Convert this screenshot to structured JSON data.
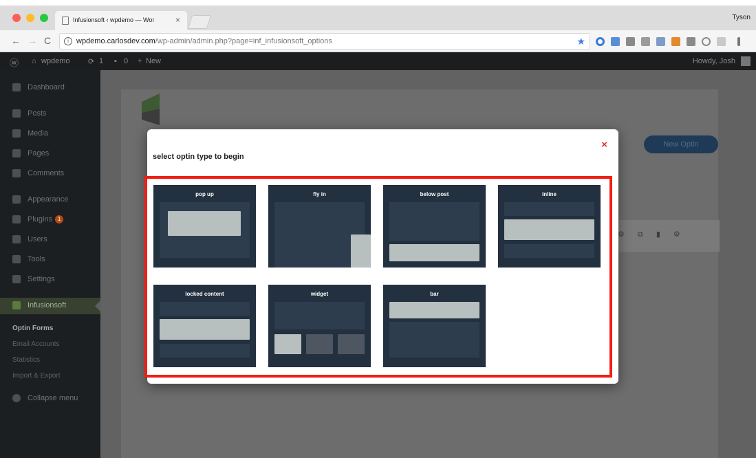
{
  "browser": {
    "tab_title": "Infusionsoft ‹ wpdemo — Wor",
    "tab_close": "×",
    "profile_name": "Tyson",
    "url_host": "wpdemo.carlosdev.com",
    "url_path": "/wp-admin/admin.php?page=inf_infusionsoft_options",
    "nav_back": "←",
    "nav_forward": "→",
    "nav_reload": "C",
    "star_icon": "★"
  },
  "adminbar": {
    "wp_logo": "ⓦ",
    "site_name": "wpdemo",
    "updates_count": "1",
    "comments_count": "0",
    "new_label": "New",
    "howdy": "Howdy, Josh"
  },
  "sidebar": {
    "items": [
      {
        "label": "Dashboard"
      },
      {
        "label": "Posts"
      },
      {
        "label": "Media"
      },
      {
        "label": "Pages"
      },
      {
        "label": "Comments"
      },
      {
        "label": "Appearance"
      },
      {
        "label": "Plugins",
        "badge": "1"
      },
      {
        "label": "Users"
      },
      {
        "label": "Tools"
      },
      {
        "label": "Settings"
      },
      {
        "label": "Infusionsoft"
      }
    ],
    "submenu": [
      "Optin Forms",
      "Email Accounts",
      "Statistics",
      "Import & Export"
    ],
    "collapse_label": "Collapse menu"
  },
  "main": {
    "new_optin_label": "New Optin",
    "row_icons": "⚙ ⧉ ▮ ⚙"
  },
  "modal": {
    "title": "select optin type to begin",
    "close": "×",
    "optin_types": [
      {
        "label": "pop up"
      },
      {
        "label": "fly in"
      },
      {
        "label": "below post"
      },
      {
        "label": "inline"
      },
      {
        "label": "locked content"
      },
      {
        "label": "widget"
      },
      {
        "label": "bar"
      }
    ]
  },
  "colors": {
    "highlight_border": "#f01e14",
    "card_background": "#22303f",
    "preview_highlight": "#b8bfbf"
  }
}
